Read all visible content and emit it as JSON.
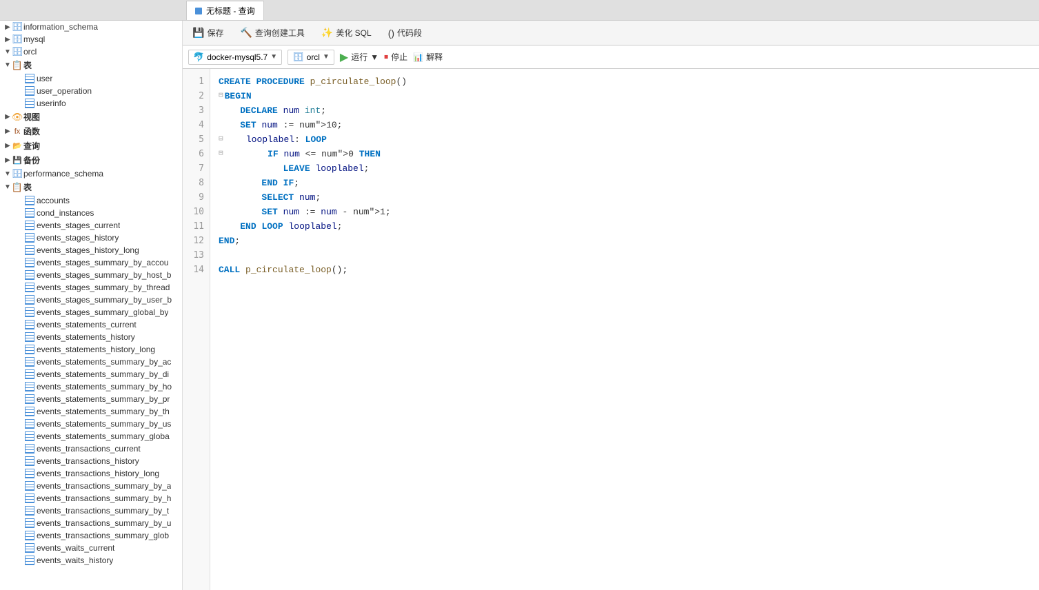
{
  "topbar": {
    "tabs": [
      {
        "label": "无标题 - 查询",
        "active": true,
        "dot_color": "#4CAF50"
      }
    ]
  },
  "toolbar": {
    "save_label": "保存",
    "query_builder_label": "查询创建工具",
    "beautify_label": "美化 SQL",
    "code_snippet_label": "代码段"
  },
  "connbar": {
    "connection": "docker-mysql5.7",
    "database": "orcl",
    "run_label": "运行",
    "stop_label": "停止",
    "explain_label": "解释"
  },
  "sidebar": {
    "databases": [
      {
        "name": "information_schema",
        "expanded": false,
        "icon": "db"
      },
      {
        "name": "mysql",
        "expanded": false,
        "icon": "db"
      },
      {
        "name": "orcl",
        "expanded": true,
        "icon": "db",
        "children": [
          {
            "type": "category",
            "label": "表",
            "expanded": true,
            "items": [
              "user",
              "user_operation",
              "userinfo"
            ]
          },
          {
            "type": "category",
            "label": "视图",
            "expanded": false
          },
          {
            "type": "category",
            "label": "函数",
            "expanded": false
          },
          {
            "type": "category",
            "label": "查询",
            "expanded": false
          },
          {
            "type": "category",
            "label": "备份",
            "expanded": false
          }
        ]
      },
      {
        "name": "performance_schema",
        "expanded": true,
        "icon": "db",
        "children": [
          {
            "type": "category",
            "label": "表",
            "expanded": true,
            "items": [
              "accounts",
              "cond_instances",
              "events_stages_current",
              "events_stages_history",
              "events_stages_history_long",
              "events_stages_summary_by_accou",
              "events_stages_summary_by_host_b",
              "events_stages_summary_by_thread",
              "events_stages_summary_by_user_b",
              "events_stages_summary_global_by",
              "events_statements_current",
              "events_statements_history",
              "events_statements_history_long",
              "events_statements_summary_by_ac",
              "events_statements_summary_by_di",
              "events_statements_summary_by_ho",
              "events_statements_summary_by_pr",
              "events_statements_summary_by_th",
              "events_statements_summary_by_us",
              "events_statements_summary_globa",
              "events_transactions_current",
              "events_transactions_history",
              "events_transactions_history_long",
              "events_transactions_summary_by_a",
              "events_transactions_summary_by_h",
              "events_transactions_summary_by_t",
              "events_transactions_summary_by_u",
              "events_transactions_summary_glob",
              "events_waits_current",
              "events_waits_history"
            ]
          }
        ]
      }
    ]
  },
  "code": {
    "lines": [
      {
        "num": 1,
        "fold": false,
        "content": "CREATE PROCEDURE p_circulate_loop()"
      },
      {
        "num": 2,
        "fold": true,
        "content": "BEGIN"
      },
      {
        "num": 3,
        "fold": false,
        "content": "    DECLARE num int;"
      },
      {
        "num": 4,
        "fold": false,
        "content": "    SET num := 10;"
      },
      {
        "num": 5,
        "fold": true,
        "content": "    looplabel: LOOP"
      },
      {
        "num": 6,
        "fold": true,
        "content": "        IF num <= 0 THEN"
      },
      {
        "num": 7,
        "fold": false,
        "content": "            LEAVE looplabel;"
      },
      {
        "num": 8,
        "fold": false,
        "content": "        END IF;"
      },
      {
        "num": 9,
        "fold": false,
        "content": "        SELECT num;"
      },
      {
        "num": 10,
        "fold": false,
        "content": "        SET num := num - 1;"
      },
      {
        "num": 11,
        "fold": false,
        "content": "    END LOOP looplabel;"
      },
      {
        "num": 12,
        "fold": false,
        "content": "END;"
      },
      {
        "num": 13,
        "fold": false,
        "content": ""
      },
      {
        "num": 14,
        "fold": false,
        "content": "CALL p_circulate_loop();"
      }
    ]
  }
}
